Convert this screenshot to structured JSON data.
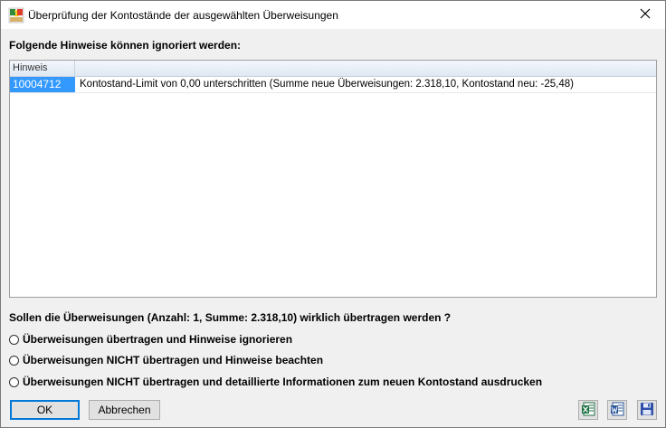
{
  "window": {
    "title": "Überprüfung der Kontostände der ausgewählten Überweisungen"
  },
  "hints_section": {
    "label": "Folgende Hinweise können ignoriert werden:",
    "column_header": "Hinweis",
    "rows": [
      {
        "id": "10004712",
        "text": "Kontostand-Limit von 0,00 unterschritten  (Summe neue Überweisungen: 2.318,10,  Kontostand neu: -25,48)"
      }
    ]
  },
  "question": "Sollen die Überweisungen (Anzahl: 1, Summe: 2.318,10) wirklich übertragen werden ?",
  "options": [
    {
      "label": "Überweisungen übertragen und Hinweise ignorieren"
    },
    {
      "label": "Überweisungen NICHT übertragen und Hinweise beachten"
    },
    {
      "label": "Überweisungen NICHT übertragen und detaillierte Informationen zum neuen Kontostand ausdrucken"
    }
  ],
  "buttons": {
    "ok": "OK",
    "cancel": "Abbrechen"
  },
  "icons": {
    "app": "bank-transfer-icon",
    "close": "close-icon",
    "excel": "excel-export-icon",
    "word": "word-export-icon",
    "save": "save-icon"
  }
}
